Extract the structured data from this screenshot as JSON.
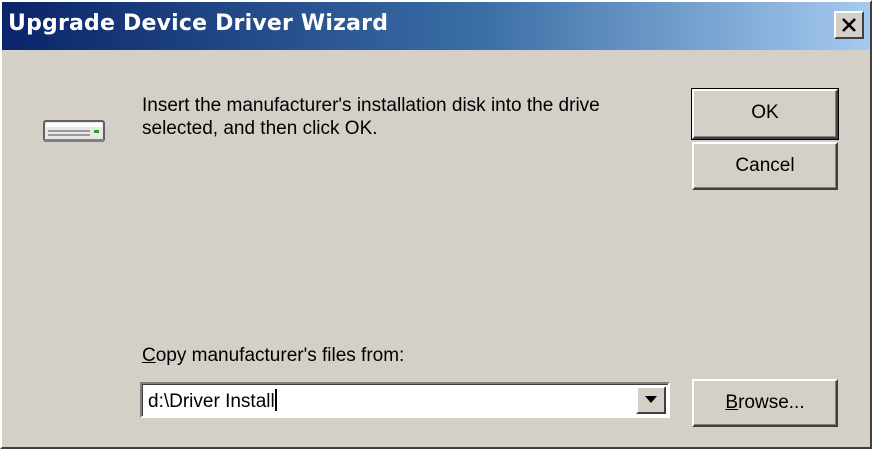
{
  "window": {
    "title": "Upgrade Device Driver Wizard"
  },
  "message": {
    "text": "Insert the manufacturer's installation disk into the drive selected, and then click OK."
  },
  "buttons": {
    "ok_label": "OK",
    "cancel_label": "Cancel",
    "browse_accel": "B",
    "browse_rest": "rowse..."
  },
  "copy_from": {
    "label_accel": "C",
    "label_rest": "opy manufacturer's files from:",
    "value": "d:\\Driver Install"
  },
  "icons": {
    "close": "close-icon",
    "drive": "disk-drive-icon",
    "dropdown": "chevron-down-icon"
  },
  "colors": {
    "titlebar_start": "#0a246a",
    "titlebar_end": "#a6caf0",
    "face": "#d4d0c8"
  }
}
